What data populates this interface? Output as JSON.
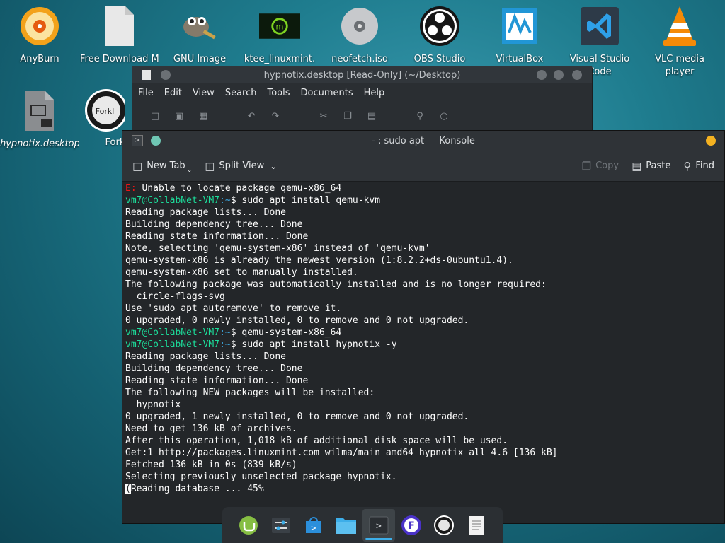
{
  "desktop": {
    "icons": [
      {
        "label": "AnyBurn"
      },
      {
        "label": "Free Download Manag"
      },
      {
        "label": "GNU Image"
      },
      {
        "label": "ktee_linuxmint."
      },
      {
        "label": "neofetch.iso"
      },
      {
        "label": "OBS Studio"
      },
      {
        "label": "VirtualBox"
      },
      {
        "label": "Visual Studio",
        "label2": "Code"
      },
      {
        "label": "VLC media",
        "label2": "player"
      },
      {
        "label": "hypnotix.desktop"
      },
      {
        "label": "Forkl"
      }
    ]
  },
  "kate": {
    "title": "hypnotix.desktop [Read-Only] (~/Desktop)",
    "menu": [
      "File",
      "Edit",
      "View",
      "Search",
      "Tools",
      "Documents",
      "Help"
    ]
  },
  "konsole": {
    "title": "- : sudo apt — Konsole",
    "toolbar": {
      "new_tab": "New Tab",
      "split_view": "Split View",
      "copy": "Copy",
      "paste": "Paste",
      "find": "Find"
    },
    "prompt_user": "vm7@CollabNet-VM7",
    "prompt_path": ":~",
    "lines": {
      "l1_err": "E:",
      "l1": " Unable to locate package qemu-x86_64",
      "l2": "$ sudo apt install qemu-kvm",
      "l3": "Reading package lists... Done",
      "l4": "Building dependency tree... Done",
      "l5": "Reading state information... Done",
      "l6": "Note, selecting 'qemu-system-x86' instead of 'qemu-kvm'",
      "l7": "qemu-system-x86 is already the newest version (1:8.2.2+ds-0ubuntu1.4).",
      "l8": "qemu-system-x86 set to manually installed.",
      "l9": "The following package was automatically installed and is no longer required:",
      "l10": "  circle-flags-svg",
      "l11": "Use 'sudo apt autoremove' to remove it.",
      "l12": "0 upgraded, 0 newly installed, 0 to remove and 0 not upgraded.",
      "l13": "$ qemu-system-x86_64",
      "l14": "$ sudo apt install hypnotix -y",
      "l15": "Reading package lists... Done",
      "l16": "Building dependency tree... Done",
      "l17": "Reading state information... Done",
      "l18": "The following NEW packages will be installed:",
      "l19": "  hypnotix",
      "l20": "0 upgraded, 1 newly installed, 0 to remove and 0 not upgraded.",
      "l21": "Need to get 136 kB of archives.",
      "l22": "After this operation, 1,018 kB of additional disk space will be used.",
      "l23": "Get:1 http://packages.linuxmint.com wilma/main amd64 hypnotix all 4.6 [136 kB]",
      "l24": "Fetched 136 kB in 0s (839 kB/s)",
      "l25": "Selecting previously unselected package hypnotix.",
      "l26_cursor": "(",
      "l26": "Reading database ... 45%"
    }
  },
  "colors": {
    "prompt_user": "#1cdc9a",
    "prompt_path": "#3daee9",
    "error": "#ed1515"
  }
}
